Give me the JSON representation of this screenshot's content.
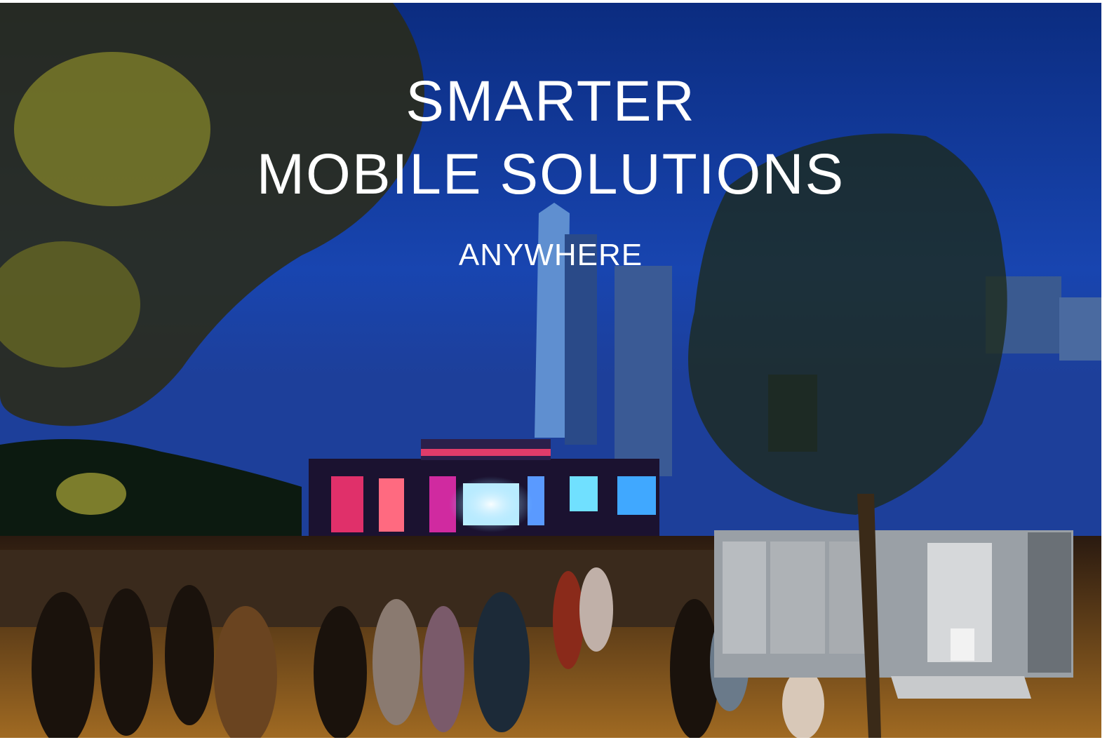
{
  "hero": {
    "headline_line1": "SMARTER",
    "headline_line2": "MOBILE SOLUTIONS",
    "subheadline": "ANYWHERE"
  },
  "colors": {
    "sky": "#123a9a",
    "text": "#ffffff",
    "stage_glow": "#e0307a",
    "ground_light": "#c88a2a"
  }
}
